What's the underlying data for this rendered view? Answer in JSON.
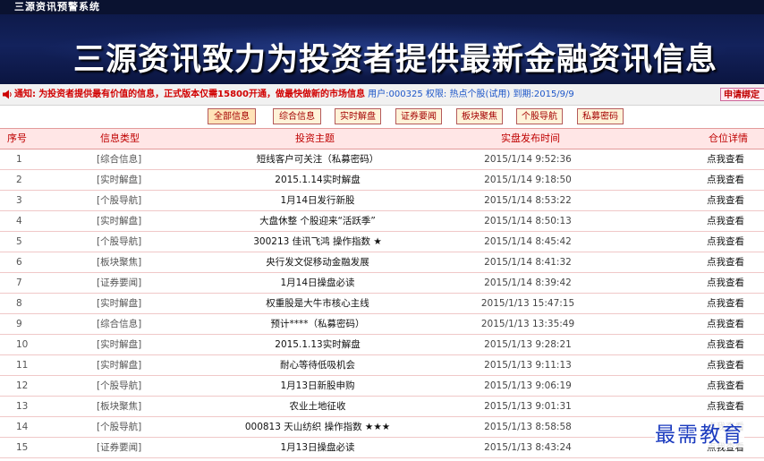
{
  "window": {
    "title": "三源资讯预警系统"
  },
  "banner": {
    "text": "三源资讯致力为投资者提供最新金融资讯信息"
  },
  "notice": {
    "label": "通知:",
    "message": "为投资者提供最有价值的信息，正式版本仅需15800开通，做最快做新的市场信息",
    "user_label": "用户:",
    "user_id": "000325",
    "permission_label": "权限:",
    "permission_value": "热点个股(试用)",
    "expiry_label": "到期:",
    "expiry_value": "2015/9/9",
    "apply_button": "申请绑定"
  },
  "tabs": [
    {
      "label": "全部信息"
    },
    {
      "label": "综合信息"
    },
    {
      "label": "实时解盘"
    },
    {
      "label": "证券要闻"
    },
    {
      "label": "板块聚焦"
    },
    {
      "label": "个股导航"
    },
    {
      "label": "私募密码"
    }
  ],
  "table": {
    "headers": [
      "序号",
      "信息类型",
      "投资主题",
      "实盘发布时间",
      "仓位详情"
    ],
    "rows": [
      {
        "no": "1",
        "type": "[综合信息]",
        "title": "短线客户可关注（私募密码）",
        "time": "2015/1/14 9:52:36",
        "detail": "点我查看"
      },
      {
        "no": "2",
        "type": "[实时解盘]",
        "title": "2015.1.14实时解盘",
        "time": "2015/1/14 9:18:50",
        "detail": "点我查看"
      },
      {
        "no": "3",
        "type": "[个股导航]",
        "title": "1月14日发行新股",
        "time": "2015/1/14 8:53:22",
        "detail": "点我查看"
      },
      {
        "no": "4",
        "type": "[实时解盘]",
        "title": "大盘休整 个股迎来“活跃季”",
        "time": "2015/1/14 8:50:13",
        "detail": "点我查看"
      },
      {
        "no": "5",
        "type": "[个股导航]",
        "title": "300213 佳讯飞鸿 操作指数 ★",
        "time": "2015/1/14 8:45:42",
        "detail": "点我查看"
      },
      {
        "no": "6",
        "type": "[板块聚焦]",
        "title": "央行发文促移动金融发展",
        "time": "2015/1/14 8:41:32",
        "detail": "点我查看"
      },
      {
        "no": "7",
        "type": "[证券要闻]",
        "title": "1月14日操盘必读",
        "time": "2015/1/14 8:39:42",
        "detail": "点我查看"
      },
      {
        "no": "8",
        "type": "[实时解盘]",
        "title": "权重股是大牛市核心主线",
        "time": "2015/1/13 15:47:15",
        "detail": "点我查看"
      },
      {
        "no": "9",
        "type": "[综合信息]",
        "title": "预计****（私募密码）",
        "time": "2015/1/13 13:35:49",
        "detail": "点我查看"
      },
      {
        "no": "10",
        "type": "[实时解盘]",
        "title": "2015.1.13实时解盘",
        "time": "2015/1/13 9:28:21",
        "detail": "点我查看"
      },
      {
        "no": "11",
        "type": "[实时解盘]",
        "title": "耐心等待低吸机会",
        "time": "2015/1/13 9:11:13",
        "detail": "点我查看"
      },
      {
        "no": "12",
        "type": "[个股导航]",
        "title": "1月13日新股申购",
        "time": "2015/1/13 9:06:19",
        "detail": "点我查看"
      },
      {
        "no": "13",
        "type": "[板块聚焦]",
        "title": "农业土地征收",
        "time": "2015/1/13 9:01:31",
        "detail": "点我查看"
      },
      {
        "no": "14",
        "type": "[个股导航]",
        "title": "000813 天山纺织 操作指数 ★★★",
        "time": "2015/1/13 8:58:58",
        "detail": "点我查看"
      },
      {
        "no": "15",
        "type": "[证券要闻]",
        "title": "1月13日操盘必读",
        "time": "2015/1/13 8:43:24",
        "detail": "点我查看"
      }
    ]
  },
  "watermark": {
    "text": "最需教育"
  },
  "colors": {
    "banner_bg": "#0e1a4a",
    "header_text": "#bf0000",
    "notice_red": "#d10000",
    "link_blue": "#1d56c9"
  }
}
